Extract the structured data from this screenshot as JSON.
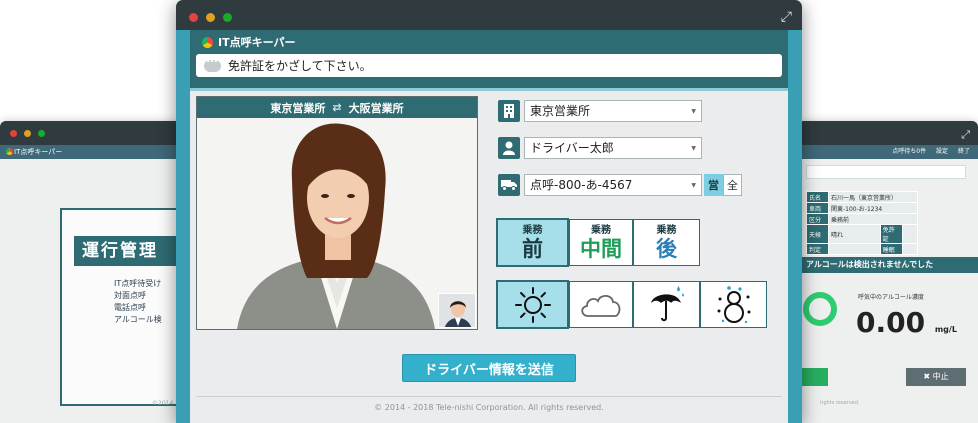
{
  "left_window": {
    "app_title": "IT点呼キーパー",
    "panel_title": "運行管理",
    "menu": [
      "IT点呼待受け",
      "対面点呼",
      "電話点呼",
      "アルコール検"
    ],
    "footer": "©2014"
  },
  "right_window": {
    "toolbar": {
      "waiting": "点呼待ち0件",
      "settings": "設定",
      "exit": "終了"
    },
    "table": [
      [
        "氏名",
        "石川一馬（東京営業所）"
      ],
      [
        "車両",
        "関東-100-お-1234"
      ],
      [
        "区分",
        "乗務前"
      ],
      [
        "天候",
        "晴れ"
      ],
      [
        "判定",
        ""
      ]
    ],
    "license_label": "免許証",
    "sleep_label": "睡眠",
    "alert": "アルコールは検出されませんでした",
    "concentration_label": "呼気中のアルコール濃度",
    "concentration_value": "0.00",
    "concentration_unit": "mg/L",
    "stop_label": "中止",
    "footer": "rights reserved."
  },
  "main_window": {
    "app_title": "IT点呼キーパー",
    "message": "免許証をかざして下さい。",
    "camera": {
      "from_office": "東京営業所",
      "to_office": "大阪営業所"
    },
    "office_select": "東京営業所",
    "driver_select": "ドライバー太郎",
    "vehicle_select": "点呼-800-あ-4567",
    "vehicle_toggle": {
      "business": "営",
      "all": "全"
    },
    "timing": [
      {
        "small": "乗務",
        "big": "前",
        "color": "#1b3a42",
        "selected": true
      },
      {
        "small": "乗務",
        "big": "中間",
        "color": "#1e9e5a",
        "selected": false
      },
      {
        "small": "乗務",
        "big": "後",
        "color": "#2a7fb8",
        "selected": false
      }
    ],
    "weather": [
      {
        "icon": "sun-icon",
        "selected": true
      },
      {
        "icon": "cloud-icon",
        "selected": false
      },
      {
        "icon": "umbrella-icon",
        "selected": false
      },
      {
        "icon": "snowman-icon",
        "selected": false
      }
    ],
    "submit_label": "ドライバー情報を送信",
    "copyright": "© 2014 - 2018 Tele-nishi Corporation. All rights reserved."
  }
}
